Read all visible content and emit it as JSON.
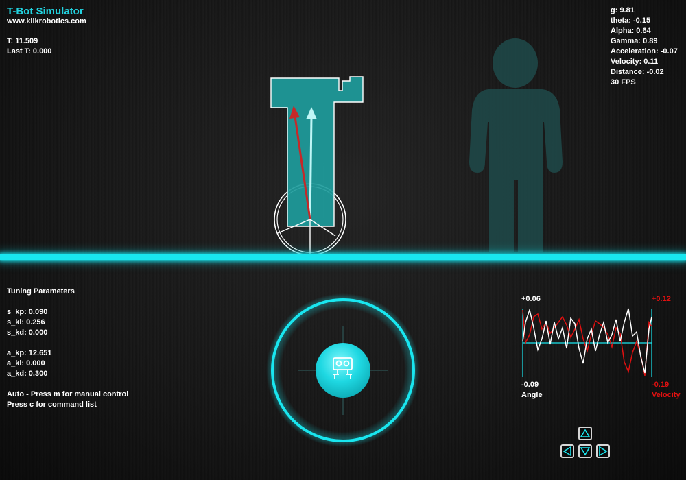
{
  "app": {
    "title": "T-Bot Simulator",
    "website": "www.klikrobotics.com"
  },
  "timing": {
    "t": "T: 11.509",
    "last_t": "Last T: 0.000"
  },
  "stats": [
    "g: 9.81",
    "theta: -0.15",
    "Alpha: 0.64",
    "Gamma: 0.89",
    "Acceleration: -0.07",
    "Velocity: 0.11",
    "Distance: -0.02",
    "30 FPS"
  ],
  "tuning": {
    "heading": "Tuning Parameters",
    "s_kp": "s_kp: 0.090",
    "s_ki": "s_ki: 0.256",
    "s_kd": "s_kd: 0.000",
    "a_kp": "a_kp: 12.651",
    "a_ki": "a_ki: 0.000",
    "a_kd": "a_kd: 0.300",
    "mode": "Auto - Press m for manual control",
    "help": "Press c for command list"
  },
  "graph": {
    "angle_max": "+0.06",
    "angle_min": "-0.09",
    "angle_label": "Angle",
    "velocity_max": "+0.12",
    "velocity_min": "-0.19",
    "velocity_label": "Velocity",
    "angle_color": "#ffffff",
    "velocity_color": "#e01010"
  },
  "colors": {
    "accent": "#19e6ef",
    "robot_body": "#1e9c9c",
    "human": "#1f4a4a",
    "tilt_arrow": "#c62828"
  },
  "icons": {
    "joystick": "robot-face-icon",
    "keys": [
      "arrow-up-icon",
      "arrow-left-icon",
      "arrow-down-icon",
      "arrow-right-icon"
    ]
  }
}
